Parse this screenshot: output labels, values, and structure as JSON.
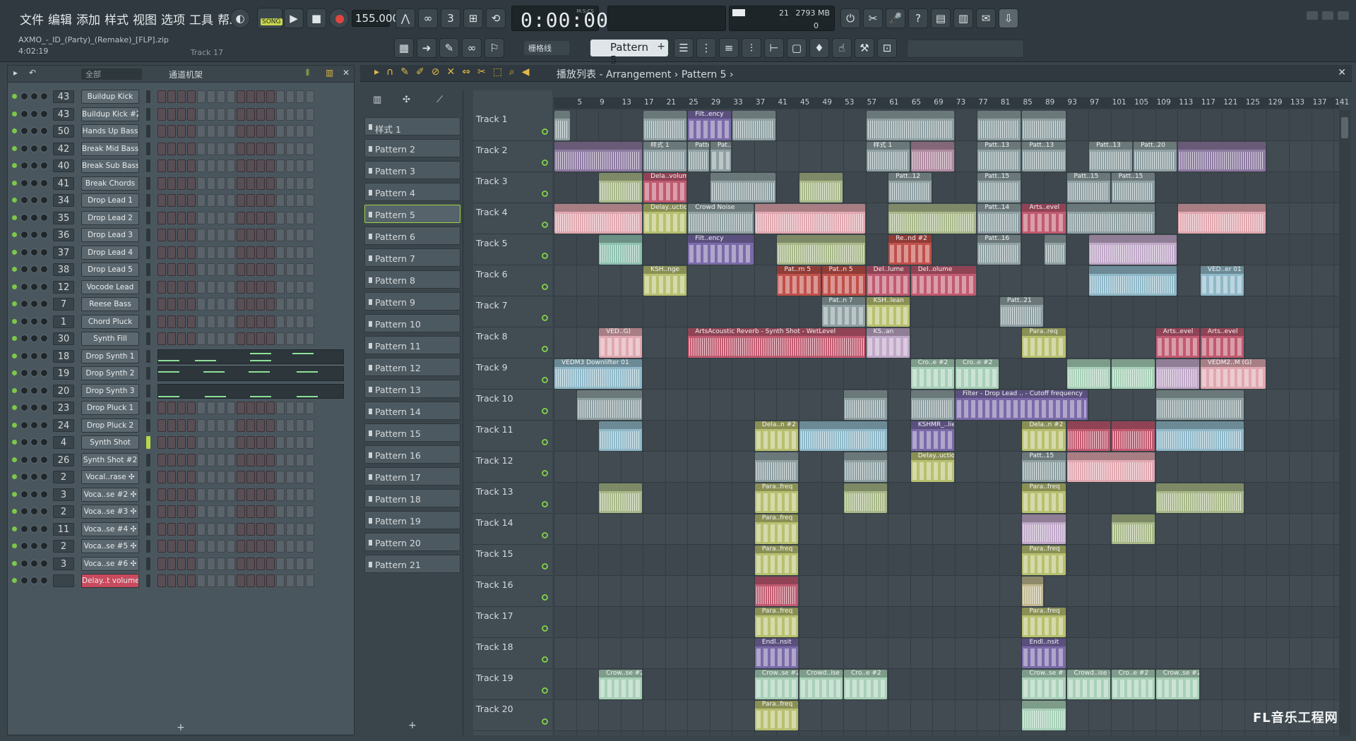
{
  "menu": [
    "文件",
    "编辑",
    "添加",
    "样式",
    "视图",
    "选项",
    "工具",
    "帮助"
  ],
  "transport": {
    "song_label": "SONG",
    "tempo": "155.000",
    "time": "0:00:00",
    "time_unit": "M:S:CS",
    "cpu": "21",
    "memory": "2793 MB",
    "polyphony": "0"
  },
  "project": {
    "filename": "AXMO_-_ID_(Party)_(Remake)_[FLP].zip",
    "duration": "4:02:19",
    "hint": "Track 17"
  },
  "toolbar2": {
    "snap": "栅格线",
    "pattern": "Pattern 5"
  },
  "rack": {
    "filter": "全部",
    "title": "通道机架",
    "add": "+",
    "channels": [
      {
        "num": "43",
        "name": "Buildup Kick",
        "type": "steps"
      },
      {
        "num": "43",
        "name": "Buildup Kick #2",
        "type": "steps"
      },
      {
        "num": "50",
        "name": "Hands Up Bass",
        "type": "steps"
      },
      {
        "num": "42",
        "name": "Break Mid Bass",
        "type": "steps"
      },
      {
        "num": "40",
        "name": "Break Sub Bass",
        "type": "steps"
      },
      {
        "num": "41",
        "name": "Break Chords",
        "type": "steps"
      },
      {
        "num": "34",
        "name": "Drop Lead 1",
        "type": "steps"
      },
      {
        "num": "35",
        "name": "Drop Lead 2",
        "type": "steps"
      },
      {
        "num": "36",
        "name": "Drop Lead 3",
        "type": "steps"
      },
      {
        "num": "37",
        "name": "Drop Lead 4",
        "type": "steps"
      },
      {
        "num": "38",
        "name": "Drop Lead 5",
        "type": "steps"
      },
      {
        "num": "12",
        "name": "Vocode Lead",
        "type": "steps"
      },
      {
        "num": "7",
        "name": "Reese Bass",
        "type": "steps"
      },
      {
        "num": "1",
        "name": "Chord Pluck",
        "type": "steps"
      },
      {
        "num": "30",
        "name": "Synth Fill",
        "type": "steps"
      },
      {
        "num": "18",
        "name": "Drop Synth 1",
        "type": "piano"
      },
      {
        "num": "19",
        "name": "Drop Synth 2",
        "type": "piano"
      },
      {
        "num": "20",
        "name": "Drop Synth 3",
        "type": "piano"
      },
      {
        "num": "23",
        "name": "Drop Pluck 1",
        "type": "steps"
      },
      {
        "num": "24",
        "name": "Drop Pluck 2",
        "type": "steps"
      },
      {
        "num": "4",
        "name": "Synth Shot",
        "type": "steps",
        "selected": true
      },
      {
        "num": "26",
        "name": "Synth Shot #2",
        "type": "steps"
      },
      {
        "num": "2",
        "name": "Vocal..rase ✣",
        "type": "steps"
      },
      {
        "num": "3",
        "name": "Voca..se #2 ✣",
        "type": "steps"
      },
      {
        "num": "2",
        "name": "Voca..se #3 ✣",
        "type": "steps"
      },
      {
        "num": "11",
        "name": "Voca..se #4 ✣",
        "type": "steps"
      },
      {
        "num": "2",
        "name": "Voca..se #5 ✣",
        "type": "steps"
      },
      {
        "num": "3",
        "name": "Voca..se #6 ✣",
        "type": "steps"
      },
      {
        "num": "",
        "name": "Delay..t volume",
        "type": "steps",
        "red": true
      }
    ]
  },
  "picker": {
    "add": "+",
    "patterns": [
      "样式 1",
      "Pattern 2",
      "Pattern 3",
      "Pattern 4",
      "Pattern 5",
      "Pattern 6",
      "Pattern 7",
      "Pattern 8",
      "Pattern 9",
      "Pattern 10",
      "Pattern 11",
      "Pattern 12",
      "Pattern 13",
      "Pattern 14",
      "Pattern 15",
      "Pattern 16",
      "Pattern 17",
      "Pattern 18",
      "Pattern 19",
      "Pattern 20",
      "Pattern 21"
    ],
    "active": 4
  },
  "playlist": {
    "title": "播放列表 - Arrangement › Pattern 5 ›",
    "bars": [
      "5",
      "9",
      "13",
      "17",
      "21",
      "25",
      "29",
      "33",
      "37",
      "41",
      "45",
      "49",
      "53",
      "57",
      "61",
      "65",
      "69",
      "73",
      "77",
      "81",
      "85",
      "89",
      "93",
      "97",
      "101",
      "105",
      "109",
      "113",
      "117",
      "121",
      "125",
      "129",
      "133",
      "137",
      "141"
    ],
    "tracks": [
      "Track 1",
      "Track 2",
      "Track 3",
      "Track 4",
      "Track 5",
      "Track 6",
      "Track 7",
      "Track 8",
      "Track 9",
      "Track 10",
      "Track 11",
      "Track 12",
      "Track 13",
      "Track 14",
      "Track 15",
      "Track 16",
      "Track 17",
      "Track 18",
      "Track 19",
      "Track 20"
    ],
    "clips": [
      {
        "t": 0,
        "b": 1,
        "len": 3,
        "label": "",
        "color": "#8fa0a3"
      },
      {
        "t": 0,
        "b": 17,
        "len": 8,
        "label": "",
        "color": "#8fa0a3"
      },
      {
        "t": 0,
        "b": 25,
        "len": 8,
        "label": "Filt..ency",
        "color": "#7a6aa8"
      },
      {
        "t": 0,
        "b": 33,
        "len": 8,
        "label": "",
        "color": "#8fa0a3"
      },
      {
        "t": 0,
        "b": 57,
        "len": 16,
        "label": "",
        "color": "#8fa0a3"
      },
      {
        "t": 0,
        "b": 77,
        "len": 8,
        "label": "",
        "color": "#8fa0a3"
      },
      {
        "t": 0,
        "b": 85,
        "len": 8,
        "label": "",
        "color": "#8fa0a3"
      },
      {
        "t": 1,
        "b": 1,
        "len": 16,
        "label": "",
        "color": "#8c7aa0"
      },
      {
        "t": 1,
        "b": 17,
        "len": 8,
        "label": "样式 1",
        "color": "#8fa0a3"
      },
      {
        "t": 1,
        "b": 25,
        "len": 4,
        "label": "Pattern 2",
        "color": "#8fa0a3"
      },
      {
        "t": 1,
        "b": 29,
        "len": 4,
        "label": "Pat..rn 3",
        "color": "#8fa0a3"
      },
      {
        "t": 1,
        "b": 57,
        "len": 8,
        "label": "样式 1",
        "color": "#8fa0a3"
      },
      {
        "t": 1,
        "b": 65,
        "len": 8,
        "label": "",
        "color": "#b08aa0"
      },
      {
        "t": 1,
        "b": 77,
        "len": 8,
        "label": "Patt..13",
        "color": "#8fa0a3"
      },
      {
        "t": 1,
        "b": 85,
        "len": 8,
        "label": "Patt..13",
        "color": "#8fa0a3"
      },
      {
        "t": 1,
        "b": 97,
        "len": 8,
        "label": "Patt..13",
        "color": "#8fa0a3"
      },
      {
        "t": 1,
        "b": 105,
        "len": 8,
        "label": "Patt..20",
        "color": "#8fa0a3"
      },
      {
        "t": 1,
        "b": 113,
        "len": 16,
        "label": "",
        "color": "#8c7aa0"
      },
      {
        "t": 2,
        "b": 9,
        "len": 8,
        "label": "",
        "color": "#a8b88a"
      },
      {
        "t": 2,
        "b": 17,
        "len": 8,
        "label": "Dela..volume",
        "color": "#c05a70"
      },
      {
        "t": 2,
        "b": 29,
        "len": 12,
        "label": "",
        "color": "#8fa0a3"
      },
      {
        "t": 2,
        "b": 45,
        "len": 8,
        "label": "",
        "color": "#a8b88a"
      },
      {
        "t": 2,
        "b": 61,
        "len": 8,
        "label": "Patt..12",
        "color": "#8fa0a3"
      },
      {
        "t": 2,
        "b": 77,
        "len": 8,
        "label": "Patt..15",
        "color": "#8fa0a3"
      },
      {
        "t": 2,
        "b": 93,
        "len": 8,
        "label": "Patt..15",
        "color": "#8fa0a3"
      },
      {
        "t": 2,
        "b": 101,
        "len": 8,
        "label": "Patt..15",
        "color": "#8fa0a3"
      },
      {
        "t": 3,
        "b": 1,
        "len": 16,
        "label": "",
        "color": "#e0a8b0"
      },
      {
        "t": 3,
        "b": 17,
        "len": 8,
        "label": "Delay..uction",
        "color": "#b8c070"
      },
      {
        "t": 3,
        "b": 25,
        "len": 12,
        "label": "Crowd Noise",
        "color": "#8fa0a3"
      },
      {
        "t": 3,
        "b": 37,
        "len": 20,
        "label": "",
        "color": "#e0a8b0"
      },
      {
        "t": 3,
        "b": 61,
        "len": 16,
        "label": "",
        "color": "#a8b88a"
      },
      {
        "t": 3,
        "b": 77,
        "len": 8,
        "label": "Patt..14",
        "color": "#8fa0a3"
      },
      {
        "t": 3,
        "b": 85,
        "len": 8,
        "label": "Arts..evel",
        "color": "#c05a70"
      },
      {
        "t": 3,
        "b": 93,
        "len": 16,
        "label": "",
        "color": "#8fa0a3"
      },
      {
        "t": 3,
        "b": 113,
        "len": 16,
        "label": "",
        "color": "#e0a8b0"
      },
      {
        "t": 4,
        "b": 9,
        "len": 8,
        "label": "",
        "color": "#8fc0b0"
      },
      {
        "t": 4,
        "b": 25,
        "len": 12,
        "label": "Filt..ency",
        "color": "#7a6aa8"
      },
      {
        "t": 4,
        "b": 41,
        "len": 16,
        "label": "",
        "color": "#a8b88a"
      },
      {
        "t": 4,
        "b": 61,
        "len": 8,
        "label": "Re..nd #2",
        "color": "#c0504a"
      },
      {
        "t": 4,
        "b": 77,
        "len": 8,
        "label": "Patt..16",
        "color": "#8fa0a3"
      },
      {
        "t": 4,
        "b": 89,
        "len": 4,
        "label": "",
        "color": "#8fa0a3"
      },
      {
        "t": 4,
        "b": 97,
        "len": 16,
        "label": "",
        "color": "#c0a8c8"
      },
      {
        "t": 5,
        "b": 17,
        "len": 8,
        "label": "KSH..nge",
        "color": "#b8c070"
      },
      {
        "t": 5,
        "b": 41,
        "len": 8,
        "label": "Pat..rn 5",
        "color": "#c0504a"
      },
      {
        "t": 5,
        "b": 49,
        "len": 8,
        "label": "Pat..n 5",
        "color": "#c0504a"
      },
      {
        "t": 5,
        "b": 57,
        "len": 8,
        "label": "Del..lume",
        "color": "#c05a70"
      },
      {
        "t": 5,
        "b": 65,
        "len": 12,
        "label": "Del..olume",
        "color": "#c05a70"
      },
      {
        "t": 5,
        "b": 97,
        "len": 16,
        "label": "",
        "color": "#8fb8c8"
      },
      {
        "t": 5,
        "b": 117,
        "len": 8,
        "label": "VED..er 01",
        "color": "#8fb8c8"
      },
      {
        "t": 6,
        "b": 49,
        "len": 8,
        "label": "Pat..n 7",
        "color": "#8fa0a3"
      },
      {
        "t": 6,
        "b": 57,
        "len": 8,
        "label": "KSH..lean",
        "color": "#b8c070"
      },
      {
        "t": 6,
        "b": 81,
        "len": 8,
        "label": "Patt..21",
        "color": "#8fa0a3"
      },
      {
        "t": 7,
        "b": 9,
        "len": 8,
        "label": "VED..G)",
        "color": "#e0a8b0"
      },
      {
        "t": 7,
        "b": 25,
        "len": 32,
        "label": "ArtsAcoustic Reverb - Synth Shot - WetLevel",
        "color": "#c05a70"
      },
      {
        "t": 7,
        "b": 57,
        "len": 8,
        "label": "KS..an",
        "color": "#c0a8c8"
      },
      {
        "t": 7,
        "b": 85,
        "len": 8,
        "label": "Para..req",
        "color": "#b8c070"
      },
      {
        "t": 7,
        "b": 109,
        "len": 8,
        "label": "Arts..evel",
        "color": "#c05a70"
      },
      {
        "t": 7,
        "b": 117,
        "len": 8,
        "label": "Arts..evel",
        "color": "#c05a70"
      },
      {
        "t": 8,
        "b": 1,
        "len": 16,
        "label": "VEDM3 Downlifter 01",
        "color": "#8fb8c8"
      },
      {
        "t": 8,
        "b": 65,
        "len": 8,
        "label": "Cro..e #2",
        "color": "#a8d0b8"
      },
      {
        "t": 8,
        "b": 73,
        "len": 8,
        "label": "Cro..e #2",
        "color": "#a8d0b8"
      },
      {
        "t": 8,
        "b": 93,
        "len": 8,
        "label": "",
        "color": "#a8d0b8"
      },
      {
        "t": 8,
        "b": 101,
        "len": 8,
        "label": "",
        "color": "#a8d0b8"
      },
      {
        "t": 8,
        "b": 109,
        "len": 8,
        "label": "",
        "color": "#c0a8c8"
      },
      {
        "t": 8,
        "b": 117,
        "len": 12,
        "label": "VEDM2..M (G)",
        "color": "#e0a8b0"
      },
      {
        "t": 9,
        "b": 5,
        "len": 12,
        "label": "",
        "color": "#8fa0a3"
      },
      {
        "t": 9,
        "b": 53,
        "len": 8,
        "label": "",
        "color": "#8fa0a3"
      },
      {
        "t": 9,
        "b": 65,
        "len": 8,
        "label": "",
        "color": "#8fa0a3"
      },
      {
        "t": 9,
        "b": 73,
        "len": 24,
        "label": "Filter - Drop Lead .. - Cutoff frequency",
        "color": "#7a6aa8"
      },
      {
        "t": 9,
        "b": 109,
        "len": 16,
        "label": "",
        "color": "#8fa0a3"
      },
      {
        "t": 10,
        "b": 9,
        "len": 8,
        "label": "",
        "color": "#8fb8c8"
      },
      {
        "t": 10,
        "b": 37,
        "len": 8,
        "label": "Dela..n #2",
        "color": "#b8c070"
      },
      {
        "t": 10,
        "b": 45,
        "len": 16,
        "label": "",
        "color": "#8fb8c8"
      },
      {
        "t": 10,
        "b": 65,
        "len": 8,
        "label": "KSHMR_..lier",
        "color": "#7a6aa8"
      },
      {
        "t": 10,
        "b": 85,
        "len": 8,
        "label": "Dela..n #2",
        "color": "#b8c070"
      },
      {
        "t": 10,
        "b": 93,
        "len": 8,
        "label": "",
        "color": "#c05a70"
      },
      {
        "t": 10,
        "b": 101,
        "len": 8,
        "label": "",
        "color": "#c05a70"
      },
      {
        "t": 10,
        "b": 109,
        "len": 16,
        "label": "",
        "color": "#8fb8c8"
      },
      {
        "t": 11,
        "b": 37,
        "len": 8,
        "label": "",
        "color": "#8fa0a3"
      },
      {
        "t": 11,
        "b": 53,
        "len": 8,
        "label": "",
        "color": "#8fa0a3"
      },
      {
        "t": 11,
        "b": 65,
        "len": 8,
        "label": "Delay..uction",
        "color": "#b8c070"
      },
      {
        "t": 11,
        "b": 85,
        "len": 8,
        "label": "Patt..15",
        "color": "#8fa0a3"
      },
      {
        "t": 11,
        "b": 93,
        "len": 16,
        "label": "",
        "color": "#e0a8b0"
      },
      {
        "t": 12,
        "b": 9,
        "len": 8,
        "label": "",
        "color": "#a8b888"
      },
      {
        "t": 12,
        "b": 37,
        "len": 8,
        "label": "Para..freq",
        "color": "#b8c070"
      },
      {
        "t": 12,
        "b": 53,
        "len": 8,
        "label": "",
        "color": "#a8b888"
      },
      {
        "t": 12,
        "b": 85,
        "len": 8,
        "label": "Para..freq",
        "color": "#b8c070"
      },
      {
        "t": 12,
        "b": 109,
        "len": 16,
        "label": "",
        "color": "#a8b888"
      },
      {
        "t": 13,
        "b": 37,
        "len": 8,
        "label": "Para..freq",
        "color": "#b8c070"
      },
      {
        "t": 13,
        "b": 85,
        "len": 8,
        "label": "",
        "color": "#c0a8c8"
      },
      {
        "t": 13,
        "b": 101,
        "len": 8,
        "label": "",
        "color": "#a8b888"
      },
      {
        "t": 14,
        "b": 37,
        "len": 8,
        "label": "Para..freq",
        "color": "#b8c070"
      },
      {
        "t": 14,
        "b": 85,
        "len": 8,
        "label": "Para..freq",
        "color": "#b8c070"
      },
      {
        "t": 15,
        "b": 37,
        "len": 8,
        "label": "",
        "color": "#c05a70"
      },
      {
        "t": 15,
        "b": 85,
        "len": 4,
        "label": "",
        "color": "#c0b890"
      },
      {
        "t": 16,
        "b": 37,
        "len": 8,
        "label": "Para..freq",
        "color": "#b8c070"
      },
      {
        "t": 16,
        "b": 85,
        "len": 8,
        "label": "Para..freq",
        "color": "#b8c070"
      },
      {
        "t": 17,
        "b": 37,
        "len": 8,
        "label": "Endl..nsit",
        "color": "#7a6aa8"
      },
      {
        "t": 17,
        "b": 85,
        "len": 8,
        "label": "Endl..nsit",
        "color": "#7a6aa8"
      },
      {
        "t": 18,
        "b": 9,
        "len": 8,
        "label": "Crow..se #2",
        "color": "#a8d0b8"
      },
      {
        "t": 18,
        "b": 37,
        "len": 8,
        "label": "Crow..se #2",
        "color": "#a8d0b8"
      },
      {
        "t": 18,
        "b": 45,
        "len": 8,
        "label": "Crowd..ise #",
        "color": "#a8d0b8"
      },
      {
        "t": 18,
        "b": 53,
        "len": 8,
        "label": "Cro..e #2",
        "color": "#a8d0b8"
      },
      {
        "t": 18,
        "b": 85,
        "len": 8,
        "label": "Crow..se #",
        "color": "#a8d0b8"
      },
      {
        "t": 18,
        "b": 93,
        "len": 8,
        "label": "Crowd..ise #",
        "color": "#a8d0b8"
      },
      {
        "t": 18,
        "b": 101,
        "len": 8,
        "label": "Cro..e #2",
        "color": "#a8d0b8"
      },
      {
        "t": 18,
        "b": 109,
        "len": 8,
        "label": "Crow..se #2",
        "color": "#a8d0b8"
      },
      {
        "t": 19,
        "b": 37,
        "len": 8,
        "label": "Para..freq",
        "color": "#b8c070"
      },
      {
        "t": 19,
        "b": 85,
        "len": 8,
        "label": "",
        "color": "#a8d0b8"
      }
    ]
  },
  "watermark": "FL音乐工程网"
}
